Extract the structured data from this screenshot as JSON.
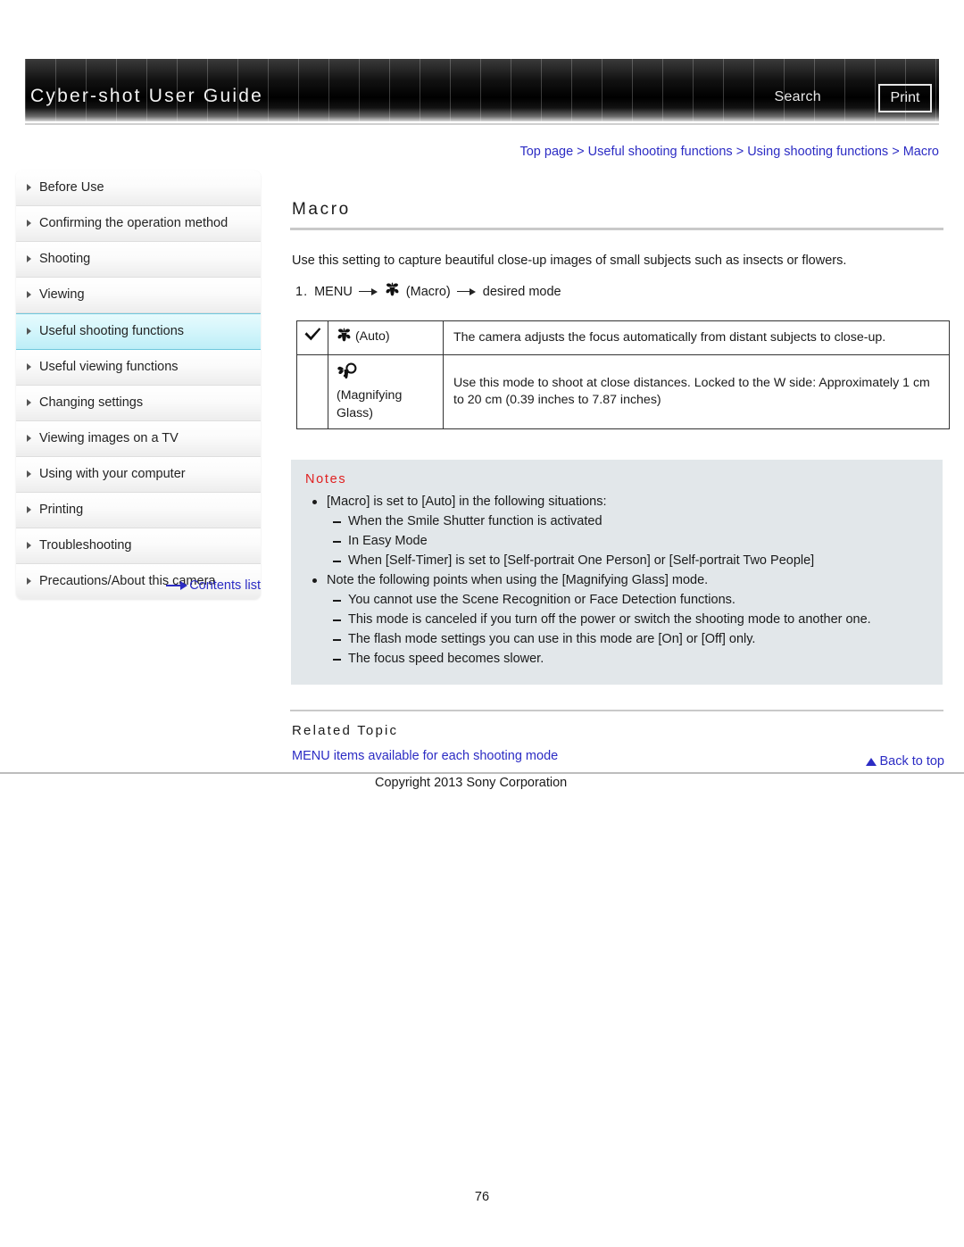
{
  "header": {
    "guide_title": "Cyber-shot User Guide",
    "search_label": "Search",
    "print_label": "Print"
  },
  "breadcrumb": {
    "items": [
      "Top page",
      "Useful shooting functions",
      "Using shooting functions",
      "Macro"
    ],
    "separator": ">",
    "full_text": "Top page > Useful shooting functions > Using shooting functions > Macro",
    "link_color": "#2c2cc4"
  },
  "sidebar": {
    "items": [
      {
        "label": "Before Use",
        "selected": false
      },
      {
        "label": "Confirming the operation method",
        "selected": false
      },
      {
        "label": "Shooting",
        "selected": false
      },
      {
        "label": "Viewing",
        "selected": false
      },
      {
        "label": "Useful shooting functions",
        "selected": true
      },
      {
        "label": "Useful viewing functions",
        "selected": false
      },
      {
        "label": "Changing settings",
        "selected": false
      },
      {
        "label": "Viewing images on a TV",
        "selected": false
      },
      {
        "label": "Using with your computer",
        "selected": false
      },
      {
        "label": "Printing",
        "selected": false
      },
      {
        "label": "Troubleshooting",
        "selected": false
      },
      {
        "label": "Precautions/About this camera",
        "selected": false
      }
    ],
    "contents_list_label": "Contents list",
    "selected_highlight_color": "#bdeef7"
  },
  "main": {
    "title": "Macro",
    "intro": "Use this setting to capture beautiful close-up images of small subjects such as insects or flowers.",
    "step": {
      "number": "1.",
      "menu_label": "MENU",
      "macro_label": "(Macro)",
      "tail_label": "desired mode"
    },
    "mode_table": {
      "rows": [
        {
          "checked": true,
          "mode_label": "(Auto)",
          "mode_label_second": "",
          "description": "The camera adjusts the focus automatically from distant subjects to close-up."
        },
        {
          "checked": false,
          "mode_label": "(Magnifying",
          "mode_label_second": "Glass)",
          "description": "Use this mode to shoot at close distances. Locked to the W side: Approximately 1 cm to 20 cm (0.39 inches to 7.87 inches)"
        }
      ]
    },
    "notes": {
      "title": "Notes",
      "title_color": "#e02020",
      "entries": [
        {
          "bullet": "[Macro] is set to [Auto] in the following situations:",
          "subs": [
            "When the Smile Shutter function is activated",
            "In Easy Mode",
            "When [Self-Timer] is set to [Self-portrait One Person] or [Self-portrait Two People]"
          ]
        },
        {
          "bullet": "Note the following points when using the [Magnifying Glass] mode.",
          "subs": [
            "You cannot use the Scene Recognition or Face Detection functions.",
            "This mode is canceled if you turn off the power or switch the shooting mode to another one.",
            "The flash mode settings you can use in this mode are [On] or [Off] only.",
            "The focus speed becomes slower."
          ]
        }
      ]
    },
    "related": {
      "title": "Related Topic",
      "link": "MENU items available for each shooting mode"
    }
  },
  "footer": {
    "back_to_top": "Back to top",
    "copyright": "Copyright 2013 Sony Corporation",
    "page_number": "76"
  }
}
